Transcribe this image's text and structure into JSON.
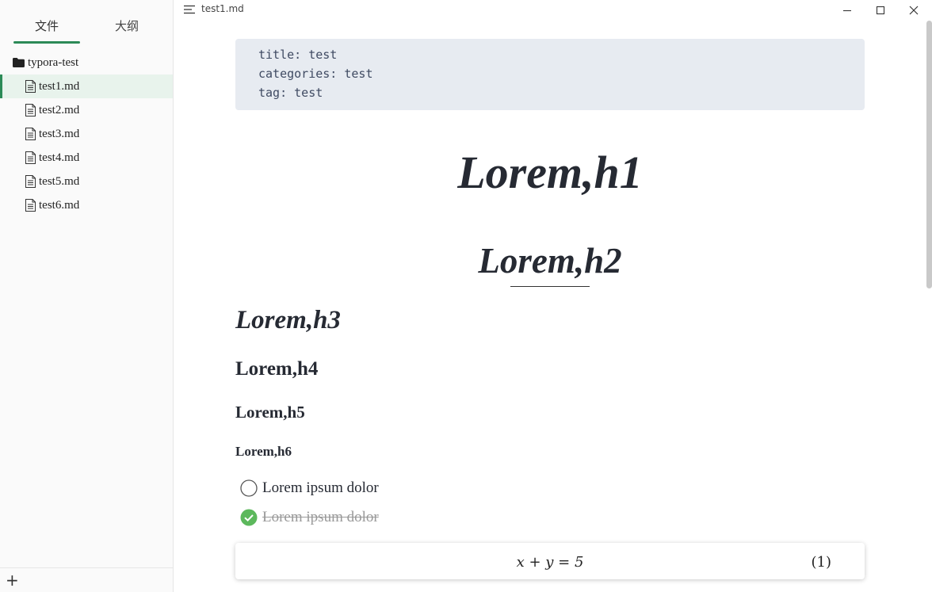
{
  "sidebar": {
    "tabs": {
      "files": "文件",
      "outline": "大纲"
    },
    "folder": {
      "name": "typora-test",
      "icon": "folder-icon"
    },
    "files": [
      {
        "name": "test1.md",
        "icon": "file-icon",
        "active": true
      },
      {
        "name": "test2.md",
        "icon": "file-icon"
      },
      {
        "name": "test3.md",
        "icon": "file-icon"
      },
      {
        "name": "test4.md",
        "icon": "file-icon"
      },
      {
        "name": "test5.md",
        "icon": "file-icon"
      },
      {
        "name": "test6.md",
        "icon": "file-icon"
      }
    ],
    "footer": {
      "add_label": "+"
    }
  },
  "titlebar": {
    "title": "test1.md"
  },
  "document": {
    "front_matter": [
      "title: test",
      "categories: test",
      "tag: test"
    ],
    "h1": "Lorem,h1",
    "h2": "Lorem,h2",
    "h3": "Lorem,h3",
    "h4": "Lorem,h4",
    "h5": "Lorem,h5",
    "h6": "Lorem,h6",
    "tasks": [
      {
        "text": "Lorem ipsum dolor",
        "checked": false
      },
      {
        "text": "Lorem ipsum dolor",
        "checked": true
      }
    ],
    "math": {
      "expression": "x + y = 5",
      "number": "(1)"
    }
  },
  "colors": {
    "accent": "#2c8a57",
    "check": "#5cb85c",
    "frontmatter_bg": "#e7ebf1"
  }
}
